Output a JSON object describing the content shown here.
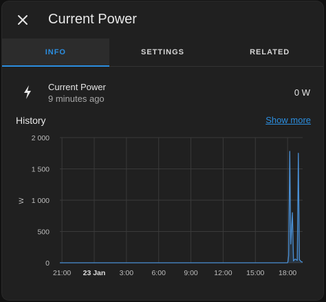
{
  "dialog": {
    "title": "Current Power"
  },
  "tabs": [
    {
      "label": "INFO",
      "active": true
    },
    {
      "label": "SETTINGS",
      "active": false
    },
    {
      "label": "RELATED",
      "active": false
    }
  ],
  "entity": {
    "icon": "lightning-bolt-icon",
    "name": "Current Power",
    "last_changed": "9 minutes ago",
    "state": "0 W"
  },
  "history": {
    "title": "History",
    "show_more_label": "Show more"
  },
  "colors": {
    "accent": "#2b8ee0",
    "series": "#4a90d6",
    "background": "#202020"
  },
  "chart_data": {
    "type": "line",
    "ylabel": "W",
    "ylim": [
      0,
      2000
    ],
    "y_ticks": [
      {
        "value": 2000,
        "label": "2 000"
      },
      {
        "value": 1500,
        "label": "1 500"
      },
      {
        "value": 1000,
        "label": "1 000"
      },
      {
        "value": 500,
        "label": "500"
      },
      {
        "value": 0,
        "label": "0"
      }
    ],
    "x_ticks": [
      {
        "hours": 0,
        "label": "21:00",
        "bold": false
      },
      {
        "hours": 3,
        "label": "23 Jan",
        "bold": true
      },
      {
        "hours": 6,
        "label": "3:00",
        "bold": false
      },
      {
        "hours": 9,
        "label": "6:00",
        "bold": false
      },
      {
        "hours": 12,
        "label": "9:00",
        "bold": false
      },
      {
        "hours": 15,
        "label": "12:00",
        "bold": false
      },
      {
        "hours": 18,
        "label": "15:00",
        "bold": false
      },
      {
        "hours": 21,
        "label": "18:00",
        "bold": false
      }
    ],
    "xlim_hours": [
      -0.2,
      22.4
    ],
    "grid": true,
    "series": [
      {
        "points": [
          [
            -0.2,
            0
          ],
          [
            21.0,
            0
          ],
          [
            21.05,
            30
          ],
          [
            21.1,
            120
          ],
          [
            21.2,
            1780
          ],
          [
            21.3,
            300
          ],
          [
            21.45,
            800
          ],
          [
            21.55,
            30
          ],
          [
            21.7,
            60
          ],
          [
            21.9,
            40
          ],
          [
            22.0,
            1750
          ],
          [
            22.1,
            50
          ],
          [
            22.25,
            20
          ],
          [
            22.4,
            10
          ]
        ]
      }
    ]
  }
}
